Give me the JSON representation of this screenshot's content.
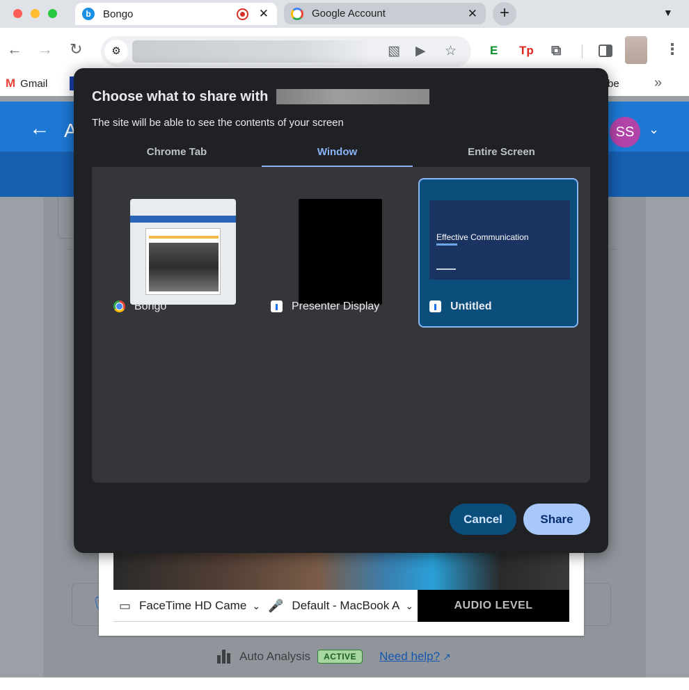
{
  "browser": {
    "tabs": [
      {
        "title": "Bongo",
        "favicon": "bongo-icon",
        "recording": true,
        "close": "✕"
      },
      {
        "title": "Google Account",
        "favicon": "google-icon",
        "close": "✕"
      }
    ],
    "new_tab": "+",
    "bookmarks": {
      "gmail": "Gmail",
      "partial_right": "be",
      "more": "»"
    }
  },
  "page": {
    "header_initial": "A",
    "avatar_initials": "SS",
    "avatar_color": "#b243a8",
    "camera_select": "FaceTime HD Came",
    "mic_select": "Default - MacBook A",
    "audio_level": "AUDIO LEVEL",
    "analysis_label": "Auto Analysis",
    "analysis_status": "ACTIVE",
    "help_link": "Need help?"
  },
  "dialog": {
    "title": "Choose what to share with",
    "subtitle": "The site will be able to see the contents of your screen",
    "tabs": [
      "Chrome Tab",
      "Window",
      "Entire Screen"
    ],
    "active_tab": "Window",
    "windows": [
      {
        "label": "Bongo",
        "icon": "chrome-icon",
        "selected": false
      },
      {
        "label": "Presenter Display",
        "icon": "keynote-icon",
        "selected": false
      },
      {
        "label": "Untitled",
        "icon": "keynote-icon",
        "selected": true,
        "preview_title": "Effective Communication"
      }
    ],
    "cancel": "Cancel",
    "share": "Share"
  },
  "colors": {
    "accent": "#8ab4f8",
    "dialog_bg": "#202124",
    "selected_bg": "#0b4e7c",
    "share_bg": "#a8c7fa",
    "page_blue": "#1d78d3"
  }
}
